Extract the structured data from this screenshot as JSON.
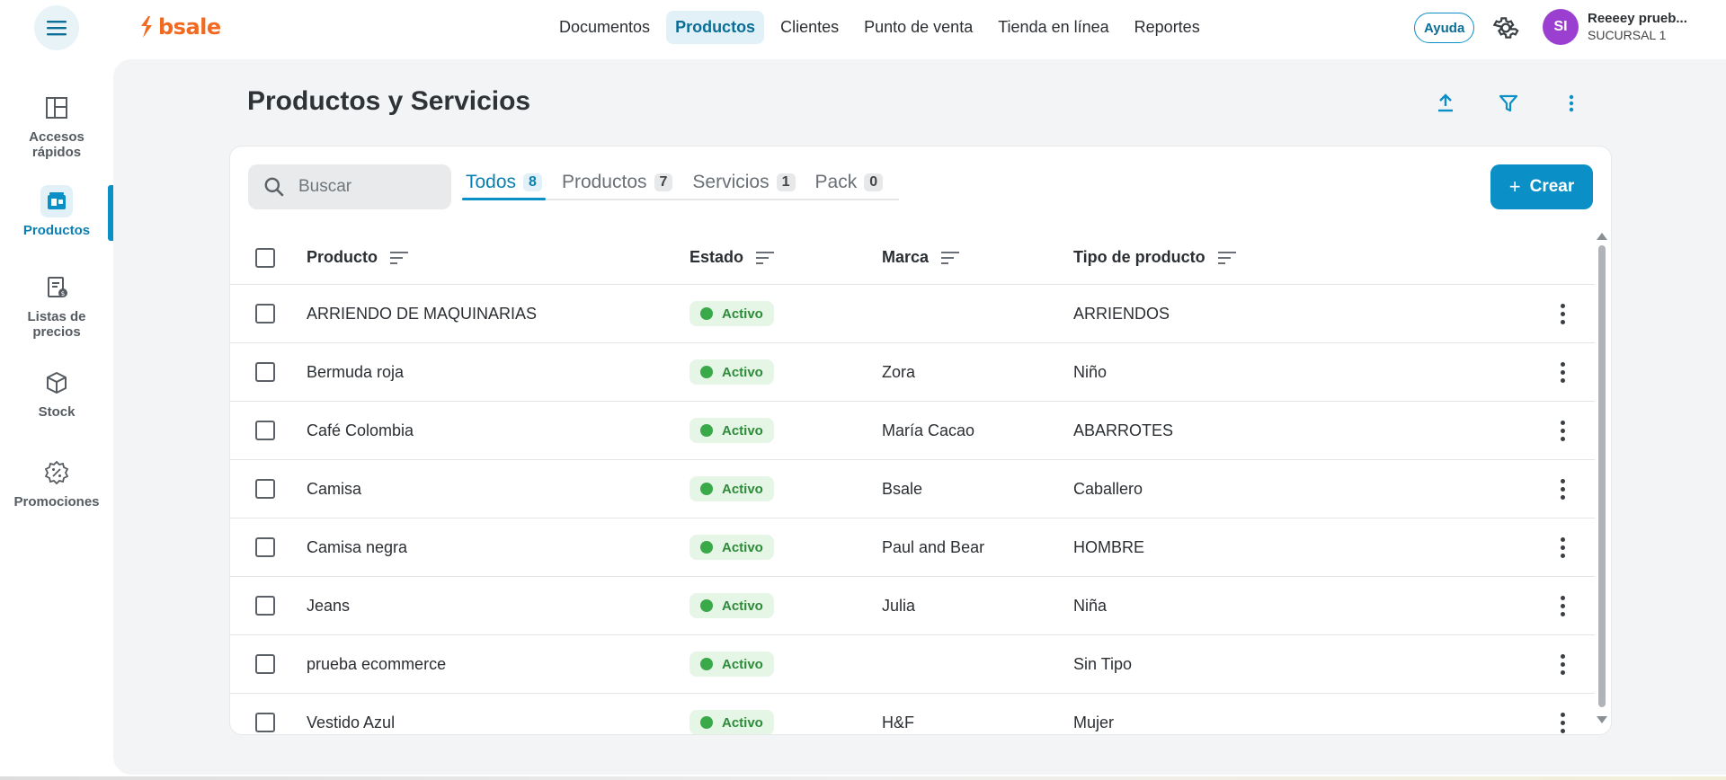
{
  "brand": {
    "name": "bsale",
    "color": "#f26a22"
  },
  "nav": {
    "items": [
      "Documentos",
      "Productos",
      "Clientes",
      "Punto de venta",
      "Tienda en línea",
      "Reportes"
    ],
    "active": "Productos"
  },
  "header": {
    "help_label": "Ayuda",
    "avatar_initials": "SI",
    "user_name": "Reeeey prueb...",
    "branch": "SUCURSAL 1"
  },
  "sidebar": {
    "items": [
      {
        "label": "Accesos\nrápidos",
        "icon": "layout-icon"
      },
      {
        "label": "Productos",
        "icon": "products-icon",
        "active": true
      },
      {
        "label": "Listas de\nprecios",
        "icon": "price-list-icon"
      },
      {
        "label": "Stock",
        "icon": "box-icon"
      },
      {
        "label": "Promociones",
        "icon": "promo-icon"
      }
    ]
  },
  "main": {
    "title": "Productos y Servicios",
    "search_placeholder": "Buscar",
    "tabs": [
      {
        "label": "Todos",
        "count": "8",
        "active": true
      },
      {
        "label": "Productos",
        "count": "7"
      },
      {
        "label": "Servicios",
        "count": "1"
      },
      {
        "label": "Pack",
        "count": "0"
      }
    ],
    "create_label": "Crear",
    "columns": [
      "Producto",
      "Estado",
      "Marca",
      "Tipo de producto"
    ],
    "rows": [
      {
        "producto": "ARRIENDO DE MAQUINARIAS",
        "estado": "Activo",
        "marca": "",
        "tipo": "ARRIENDOS"
      },
      {
        "producto": "Bermuda roja",
        "estado": "Activo",
        "marca": "Zora",
        "tipo": "Niño"
      },
      {
        "producto": "Café Colombia",
        "estado": "Activo",
        "marca": "María Cacao",
        "tipo": "ABARROTES"
      },
      {
        "producto": "Camisa",
        "estado": "Activo",
        "marca": "Bsale",
        "tipo": "Caballero"
      },
      {
        "producto": "Camisa negra",
        "estado": "Activo",
        "marca": "Paul and Bear",
        "tipo": "HOMBRE"
      },
      {
        "producto": "Jeans",
        "estado": "Activo",
        "marca": "Julia",
        "tipo": "Niña"
      },
      {
        "producto": "prueba ecommerce",
        "estado": "Activo",
        "marca": "",
        "tipo": "Sin Tipo"
      },
      {
        "producto": "Vestido Azul",
        "estado": "Activo",
        "marca": "H&F",
        "tipo": "Mujer"
      }
    ]
  },
  "colors": {
    "accent": "#0b8fc7",
    "status_active": "#3aa94a",
    "avatar": "#9b3fd1"
  }
}
